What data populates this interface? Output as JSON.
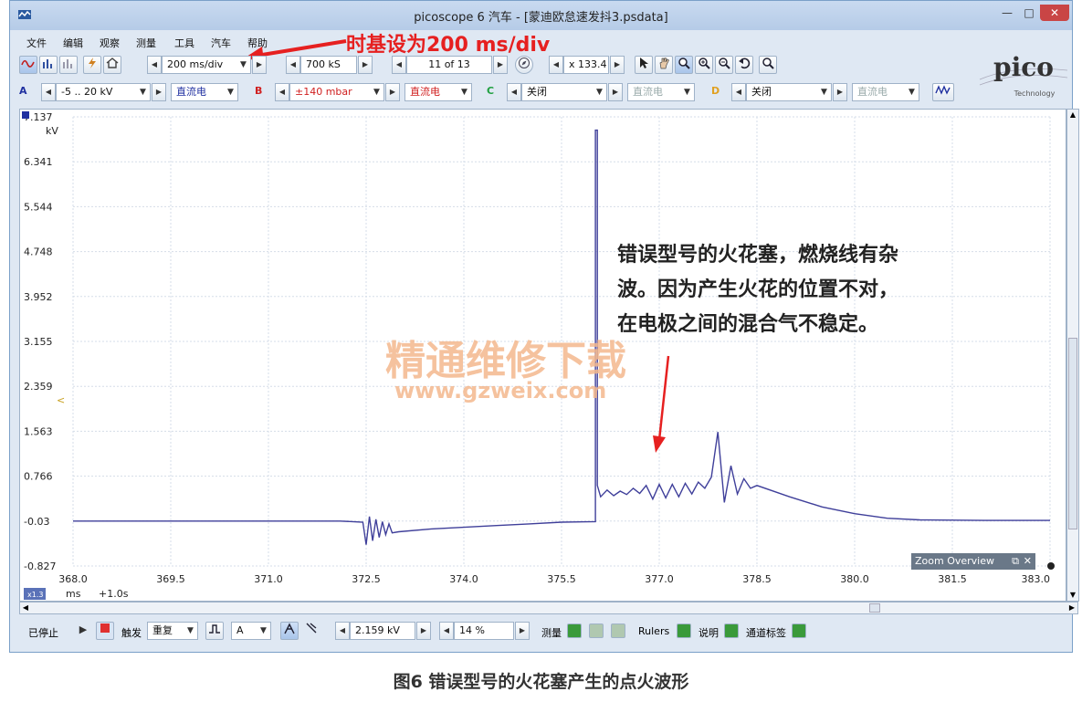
{
  "window": {
    "title": "picoscope 6 汽车 - [蒙迪欧怠速发抖3.psdata]",
    "min_glyph": "—",
    "max_glyph": "□",
    "close_glyph": "✕"
  },
  "menu": [
    "文件",
    "编辑",
    "观察",
    "测量",
    "工具",
    "汽车",
    "帮助"
  ],
  "annotation_timebase": "时基设为200 ms/div",
  "toolbar": {
    "timebase": "200 ms/div",
    "samples": "700 kS",
    "buffer": "11 of 13",
    "zoom": "x 133.4"
  },
  "channels": {
    "a": {
      "label": "A",
      "range": "-5 .. 20 kV",
      "coupling": "直流电",
      "color": "#2030a0"
    },
    "b": {
      "label": "B",
      "range": "±140 mbar",
      "coupling": "直流电",
      "color": "#d02020"
    },
    "c": {
      "label": "C",
      "range": "关闭",
      "coupling": "直流电",
      "color": "#20a040"
    },
    "d": {
      "label": "D",
      "range": "关闭",
      "coupling": "直流电",
      "color": "#e0a020"
    }
  },
  "logo": {
    "name": "pico",
    "sub": "Technology"
  },
  "chart_data": {
    "type": "line",
    "xlabel": "ms",
    "ylabel": "kV",
    "xlim": [
      368.0,
      383.0
    ],
    "ylim": [
      -0.827,
      7.137
    ],
    "x_ticks": [
      "368.0",
      "369.5",
      "371.0",
      "372.5",
      "374.0",
      "375.5",
      "377.0",
      "378.5",
      "380.0",
      "381.5",
      "383.0"
    ],
    "y_ticks": [
      "7.137",
      "6.341",
      "5.544",
      "4.748",
      "3.952",
      "3.155",
      "2.359",
      "1.563",
      "0.766",
      "-0.03",
      "-0.827"
    ],
    "x_offset_label": "+1.0s",
    "x_zoom_badge": "x1.3",
    "grid": true,
    "series": [
      {
        "color": "#3f3f9a",
        "points": [
          [
            368.0,
            -0.03
          ],
          [
            370.0,
            -0.03
          ],
          [
            372.1,
            -0.03
          ],
          [
            372.45,
            -0.05
          ],
          [
            372.5,
            -0.45
          ],
          [
            372.55,
            0.05
          ],
          [
            372.6,
            -0.38
          ],
          [
            372.65,
            0.0
          ],
          [
            372.7,
            -0.32
          ],
          [
            372.75,
            -0.04
          ],
          [
            372.8,
            -0.27
          ],
          [
            372.85,
            -0.08
          ],
          [
            372.9,
            -0.24
          ],
          [
            373.0,
            -0.22
          ],
          [
            373.5,
            -0.17
          ],
          [
            374.0,
            -0.14
          ],
          [
            374.5,
            -0.11
          ],
          [
            375.0,
            -0.08
          ],
          [
            375.5,
            -0.05
          ],
          [
            376.02,
            -0.04
          ],
          [
            376.02,
            6.9
          ],
          [
            376.05,
            6.9
          ],
          [
            376.05,
            0.6
          ],
          [
            376.1,
            0.4
          ],
          [
            376.2,
            0.52
          ],
          [
            376.3,
            0.42
          ],
          [
            376.4,
            0.5
          ],
          [
            376.5,
            0.44
          ],
          [
            376.6,
            0.55
          ],
          [
            376.7,
            0.46
          ],
          [
            376.8,
            0.6
          ],
          [
            376.9,
            0.36
          ],
          [
            377.0,
            0.62
          ],
          [
            377.1,
            0.38
          ],
          [
            377.2,
            0.62
          ],
          [
            377.3,
            0.4
          ],
          [
            377.4,
            0.64
          ],
          [
            377.5,
            0.45
          ],
          [
            377.6,
            0.66
          ],
          [
            377.7,
            0.55
          ],
          [
            377.8,
            0.75
          ],
          [
            377.9,
            1.55
          ],
          [
            378.0,
            0.3
          ],
          [
            378.1,
            0.95
          ],
          [
            378.2,
            0.45
          ],
          [
            378.3,
            0.72
          ],
          [
            378.4,
            0.55
          ],
          [
            378.5,
            0.6
          ],
          [
            379.0,
            0.4
          ],
          [
            379.5,
            0.22
          ],
          [
            380.0,
            0.1
          ],
          [
            380.5,
            0.02
          ],
          [
            381.0,
            -0.01
          ],
          [
            382.0,
            -0.02
          ],
          [
            383.0,
            -0.02
          ]
        ]
      }
    ]
  },
  "zoom_overview": "Zoom Overview",
  "note_lines": [
    "错误型号的火花塞，燃烧线有杂",
    "波。因为产生火花的位置不对，",
    "在电极之间的混合气不稳定。"
  ],
  "watermark": {
    "cn": "精通维修下载",
    "url": "www.gzweix.com"
  },
  "bottom": {
    "status": "已停止",
    "trigger_label": "触发",
    "trigger_mode": "重复",
    "trigger_channel": "A",
    "level": "2.159 kV",
    "pretrigger": "14 %",
    "measure": "测量",
    "rulers": "Rulers",
    "notes": "说明",
    "channel_labels": "通道标签"
  },
  "caption": "图6 错误型号的火花塞产生的点火波形"
}
